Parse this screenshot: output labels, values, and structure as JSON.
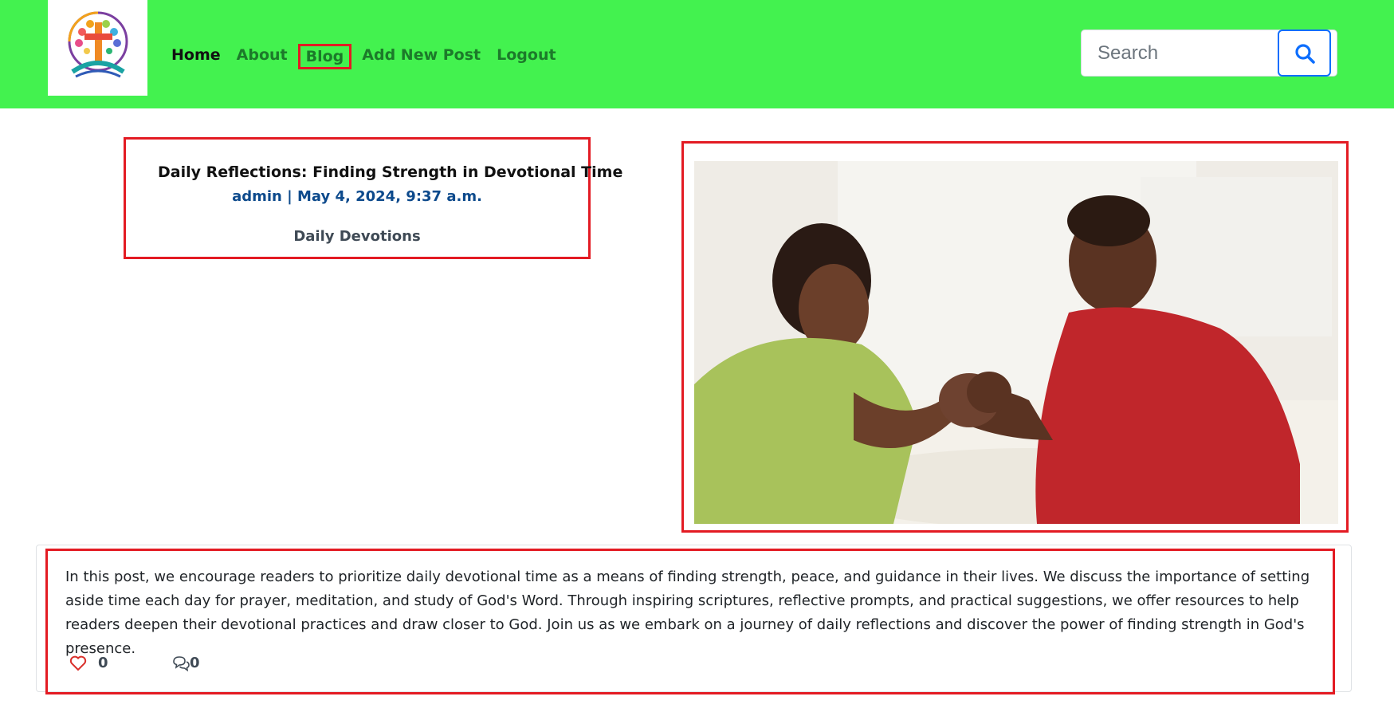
{
  "navbar": {
    "background": "#43f24f",
    "logo": "church-cross-tree-logo",
    "links": [
      {
        "label": "Home"
      },
      {
        "label": "About"
      },
      {
        "label": "Blog"
      },
      {
        "label": "Add New Post"
      },
      {
        "label": "Logout"
      }
    ],
    "search": {
      "placeholder": "Search",
      "button_icon": "search-icon"
    }
  },
  "post": {
    "title": "Daily Reflections: Finding Strength in Devotional Time",
    "meta": "admin | May 4, 2024, 9:37 a.m.",
    "category": "Daily Devotions",
    "image": "couple-praying-photo",
    "body": "In this post, we encourage readers to prioritize daily devotional time as a means of finding strength, peace, and guidance in their lives. We discuss the importance of setting aside time each day for prayer, meditation, and study of God's Word. Through inspiring scriptures, reflective prompts, and practical suggestions, we offer resources to help readers deepen their devotional practices and draw closer to God. Join us as we embark on a journey of daily reflections and discover the power of finding strength in God's presence.",
    "likes": "0",
    "like_icon": "heart-icon",
    "comments": "0",
    "comment_icon": "comments-icon"
  },
  "colors": {
    "highlight_border": "#e31b23",
    "meta_text": "#0d4a8c",
    "search_button": "#0d6efd"
  }
}
